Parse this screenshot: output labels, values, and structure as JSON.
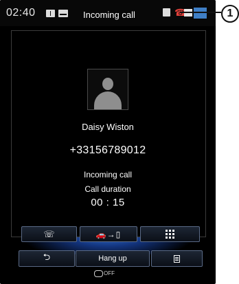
{
  "status_bar": {
    "time": "02:40",
    "title": "Incoming call",
    "accent_blue": "#3f7fc6",
    "phone_color": "#e0403a"
  },
  "callout": {
    "label": "1"
  },
  "contact": {
    "name": "Daisy Wiston",
    "number": "+33156789012"
  },
  "call": {
    "status": "Incoming call",
    "duration_label": "Call duration",
    "duration": "00 : 15"
  },
  "actions": {
    "row1": [
      {
        "icon": "handset-icon"
      },
      {
        "icon": "car-to-phone-transfer-icon"
      },
      {
        "icon": "keypad-icon"
      }
    ],
    "row2": [
      {
        "icon": "back-arrow-icon"
      },
      {
        "label": "Hang up"
      },
      {
        "icon": "menu-icon"
      }
    ]
  },
  "footer": {
    "label": "OFF"
  }
}
